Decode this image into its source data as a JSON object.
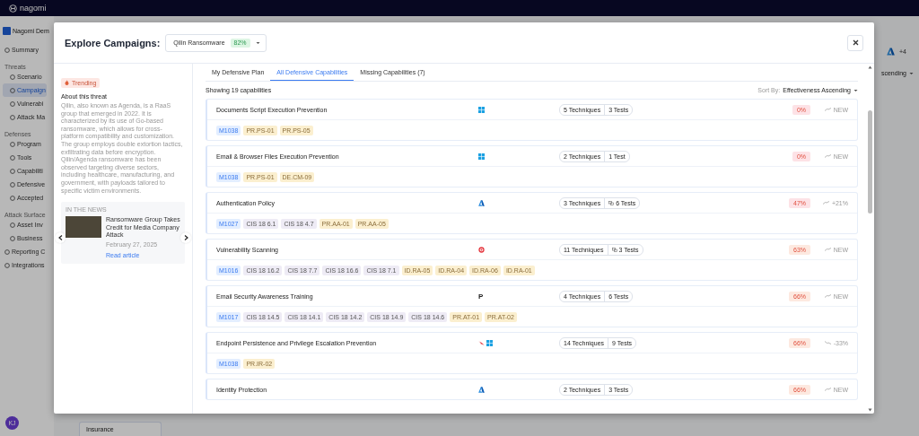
{
  "app": {
    "logo": "nagomi",
    "workspace": "Nagomi Dem",
    "avatar": "KJ",
    "extra_count": "+4",
    "sort_field": "scending",
    "card_label": "Insurance"
  },
  "sidebar": {
    "items": [
      {
        "label": "Summary",
        "kind": "item",
        "selected": false
      },
      {
        "label": "Threats",
        "kind": "section",
        "children": [
          {
            "label": "Scenario",
            "selected": false
          },
          {
            "label": "Campaign",
            "selected": true
          },
          {
            "label": "Vulnerabi",
            "selected": false
          },
          {
            "label": "Attack Ma",
            "selected": false
          }
        ]
      },
      {
        "label": "Defenses",
        "kind": "section",
        "children": [
          {
            "label": "Program",
            "selected": false
          },
          {
            "label": "Tools",
            "selected": false
          },
          {
            "label": "Capabiliti",
            "selected": false
          },
          {
            "label": "Defensive",
            "selected": false
          },
          {
            "label": "Accepted",
            "selected": false
          }
        ]
      },
      {
        "label": "Attack Surface",
        "kind": "section",
        "children": [
          {
            "label": "Asset Inv",
            "selected": false
          },
          {
            "label": "Business",
            "selected": false
          }
        ]
      },
      {
        "label": "Reporting C",
        "kind": "item",
        "selected": false
      },
      {
        "label": "Integrations",
        "kind": "item",
        "selected": false
      }
    ]
  },
  "modal": {
    "title": "Explore Campaigns:",
    "campaign": {
      "name": "Qilin Ransomware",
      "score": "82%"
    },
    "trending": "Trending",
    "about_title": "About this threat",
    "about_text": "Qilin, also known as Agenda, is a RaaS group that emerged in 2022. It is characterized by its use of Go-based ransomware, which allows for cross-platform compatibility and customization. The group employs double extortion tactics, exfiltrating data before encryption. Qilin/Agenda ransomware has been observed targeting diverse sectors, including healthcare, manufacturing, and government, with payloads tailored to specific victim environments.",
    "news": {
      "heading": "IN THE NEWS",
      "title": "Ransomware Group Takes Credit for Media Company Attack",
      "date": "February 27, 2025",
      "link": "Read article"
    },
    "tabs": [
      {
        "label": "My Defensive Plan",
        "selected": false
      },
      {
        "label": "All Defensive Capabilities",
        "selected": true
      },
      {
        "label": "Missing Capabilities (7)",
        "selected": false
      }
    ],
    "count_text": "Showing 19 capabilities",
    "sort_label": "Sort By:",
    "sort_value": "Effectiveness Ascending",
    "cards": [
      {
        "name": "Documents Script Execution Prevention",
        "vendors": [
          {
            "kind": "windows"
          }
        ],
        "tags": [
          {
            "label": "M1038",
            "kind": "mitre"
          },
          {
            "label": "PR.PS-01",
            "kind": "nist"
          },
          {
            "label": "PR.PS-05",
            "kind": "nist"
          }
        ],
        "techniques": "5 Techniques",
        "tests": "3 Tests",
        "tests_icon": false,
        "score": "0%",
        "color": "#fde2e6",
        "trend": "NEW",
        "trend_down": false
      },
      {
        "name": "Email & Browser Files Execution Prevention",
        "vendors": [
          {
            "kind": "windows"
          }
        ],
        "tags": [
          {
            "label": "M1038",
            "kind": "mitre"
          },
          {
            "label": "PR.PS-01",
            "kind": "nist"
          },
          {
            "label": "DE.CM-09",
            "kind": "nist"
          }
        ],
        "techniques": "2 Techniques",
        "tests": "1 Test",
        "tests_icon": false,
        "score": "0%",
        "color": "#fde2e6",
        "trend": "NEW",
        "trend_down": false
      },
      {
        "name": "Authentication Policy",
        "vendors": [
          {
            "kind": "azure"
          }
        ],
        "tags": [
          {
            "label": "M1027",
            "kind": "mitre"
          },
          {
            "label": "CIS 18 6.1",
            "kind": "cis"
          },
          {
            "label": "CIS 18 4.7",
            "kind": "cis"
          },
          {
            "label": "PR.AA-01",
            "kind": "nist"
          },
          {
            "label": "PR.AA-05",
            "kind": "nist"
          }
        ],
        "techniques": "3 Techniques",
        "tests": "6 Tests",
        "tests_icon": true,
        "score": "47%",
        "color": "#fde2e6",
        "trend": "+21%",
        "trend_down": false
      },
      {
        "name": "Vulnerability Scanning",
        "vendors": [
          {
            "kind": "target"
          }
        ],
        "tags": [
          {
            "label": "M1016",
            "kind": "mitre"
          },
          {
            "label": "CIS 18 16.2",
            "kind": "cis"
          },
          {
            "label": "CIS 18 7.7",
            "kind": "cis"
          },
          {
            "label": "CIS 18 16.6",
            "kind": "cis"
          },
          {
            "label": "CIS 18 7.1",
            "kind": "cis"
          },
          {
            "label": "ID.RA-05",
            "kind": "nist"
          },
          {
            "label": "ID.RA-04",
            "kind": "nist"
          },
          {
            "label": "ID.RA-06",
            "kind": "nist"
          },
          {
            "label": "ID.RA-01",
            "kind": "nist"
          }
        ],
        "techniques": "11 Techniques",
        "tests": "3 Tests",
        "tests_icon": true,
        "score": "63%",
        "color": "#fde9e0",
        "trend": "NEW",
        "trend_down": false
      },
      {
        "name": "Email Security Awareness Training",
        "vendors": [
          {
            "kind": "letter",
            "text": "P"
          }
        ],
        "tags": [
          {
            "label": "M1017",
            "kind": "mitre"
          },
          {
            "label": "CIS 18 14.5",
            "kind": "cis"
          },
          {
            "label": "CIS 18 14.1",
            "kind": "cis"
          },
          {
            "label": "CIS 18 14.2",
            "kind": "cis"
          },
          {
            "label": "CIS 18 14.9",
            "kind": "cis"
          },
          {
            "label": "CIS 18 14.6",
            "kind": "cis"
          },
          {
            "label": "PR.AT-01",
            "kind": "nist"
          },
          {
            "label": "PR.AT-02",
            "kind": "nist"
          }
        ],
        "techniques": "4 Techniques",
        "tests": "6 Tests",
        "tests_icon": false,
        "score": "66%",
        "color": "#fde9e0",
        "trend": "NEW",
        "trend_down": false
      },
      {
        "name": "Endpoint Persistence and Privilege Escalation Prevention",
        "vendors": [
          {
            "kind": "bird"
          },
          {
            "kind": "windows"
          }
        ],
        "tags": [
          {
            "label": "M1038",
            "kind": "mitre"
          },
          {
            "label": "PR.IR-02",
            "kind": "nist"
          }
        ],
        "techniques": "14 Techniques",
        "tests": "9 Tests",
        "tests_icon": false,
        "score": "66%",
        "color": "#fde9e0",
        "trend": "-33%",
        "trend_down": true
      },
      {
        "name": "Identity Protection",
        "vendors": [
          {
            "kind": "azure"
          }
        ],
        "techniques": "2 Techniques",
        "tests": "3 Tests",
        "tests_icon": false,
        "score": "66%",
        "color": "#fde9e0",
        "trend": "NEW",
        "trend_down": false
      }
    ]
  }
}
